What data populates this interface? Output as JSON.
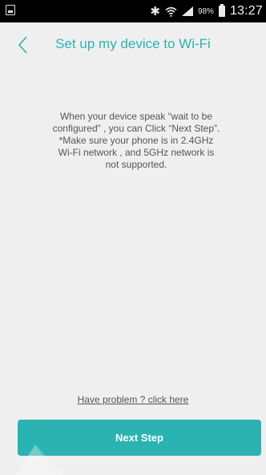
{
  "status_bar": {
    "bluetooth_icon": "bluetooth-icon",
    "wifi_icon": "wifi-icon",
    "signal_icon": "signal-icon",
    "battery_percent": "98%",
    "time": "13:27"
  },
  "header": {
    "back_icon": "chevron-left-icon",
    "title": "Set up my device to Wi-Fi"
  },
  "main": {
    "instructions": "When your device speak “wait to be\nconfigured” , you can Click “Next Step”.\n*Make sure your phone is in 2.4GHz\nWi-Fi network , and 5GHz network is\nnot supported."
  },
  "footer": {
    "help_link": "Have problem ? click here",
    "next_button": "Next Step"
  },
  "colors": {
    "accent": "#2ab3b0",
    "background": "#efefef",
    "status_bar": "#000000",
    "body_text": "#555555"
  }
}
